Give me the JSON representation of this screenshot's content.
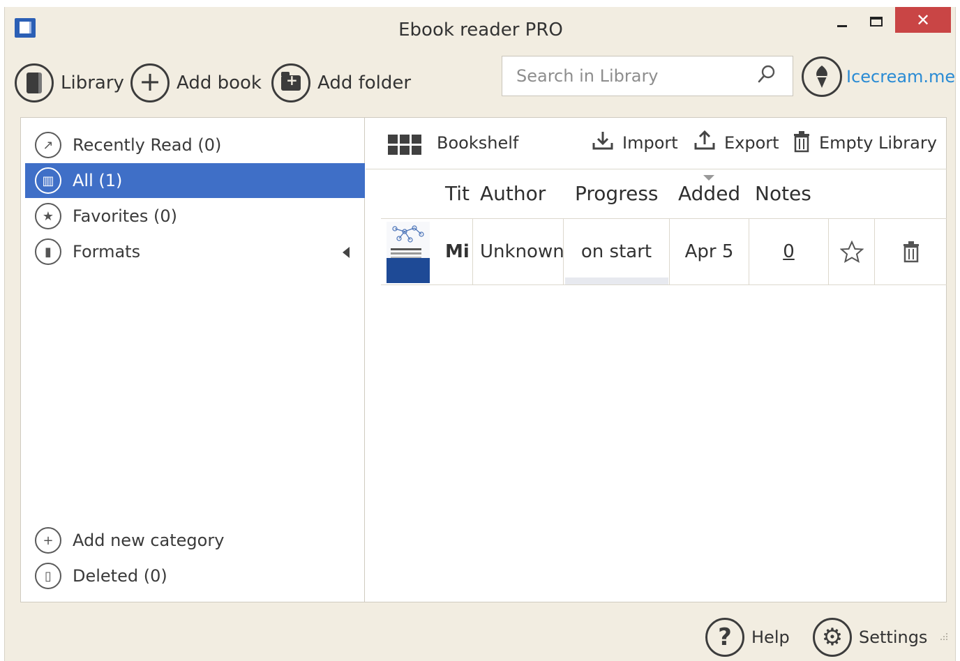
{
  "window": {
    "title": "Ebook reader PRO",
    "close_glyph": "✕"
  },
  "toolbar": {
    "library_label": "Library",
    "add_book_label": "Add book",
    "add_folder_label": "Add folder",
    "search_placeholder": "Search in Library",
    "brand_label": "Icecream.me"
  },
  "sidebar": {
    "items": [
      {
        "label": "Recently Read (0)",
        "icon": "recently-read-icon",
        "selected": false
      },
      {
        "label": "All (1)",
        "icon": "all-books-icon",
        "selected": true
      },
      {
        "label": "Favorites (0)",
        "icon": "star-icon",
        "selected": false
      },
      {
        "label": "Formats",
        "icon": "formats-icon",
        "selected": false
      }
    ],
    "bottom_items": [
      {
        "label": "Add new category",
        "icon": "plus-icon"
      },
      {
        "label": "Deleted (0)",
        "icon": "trash-icon"
      }
    ]
  },
  "content": {
    "view_label": "Bookshelf",
    "import_label": "Import",
    "export_label": "Export",
    "empty_library_label": "Empty Library",
    "columns": [
      "Tit",
      "Author",
      "Progress",
      "Added",
      "Notes"
    ],
    "sorted_column": "Added",
    "books": [
      {
        "title": "Mi",
        "author": "Unknown",
        "progress_text": "on start",
        "progress": 0,
        "added": "Apr 5",
        "notes": "0"
      }
    ]
  },
  "footer": {
    "help_label": "Help",
    "settings_label": "Settings"
  },
  "colors": {
    "accent": "#3f6fc7",
    "close": "#c94545",
    "link": "#2a8bd4",
    "window_bg": "#f2ede1"
  }
}
